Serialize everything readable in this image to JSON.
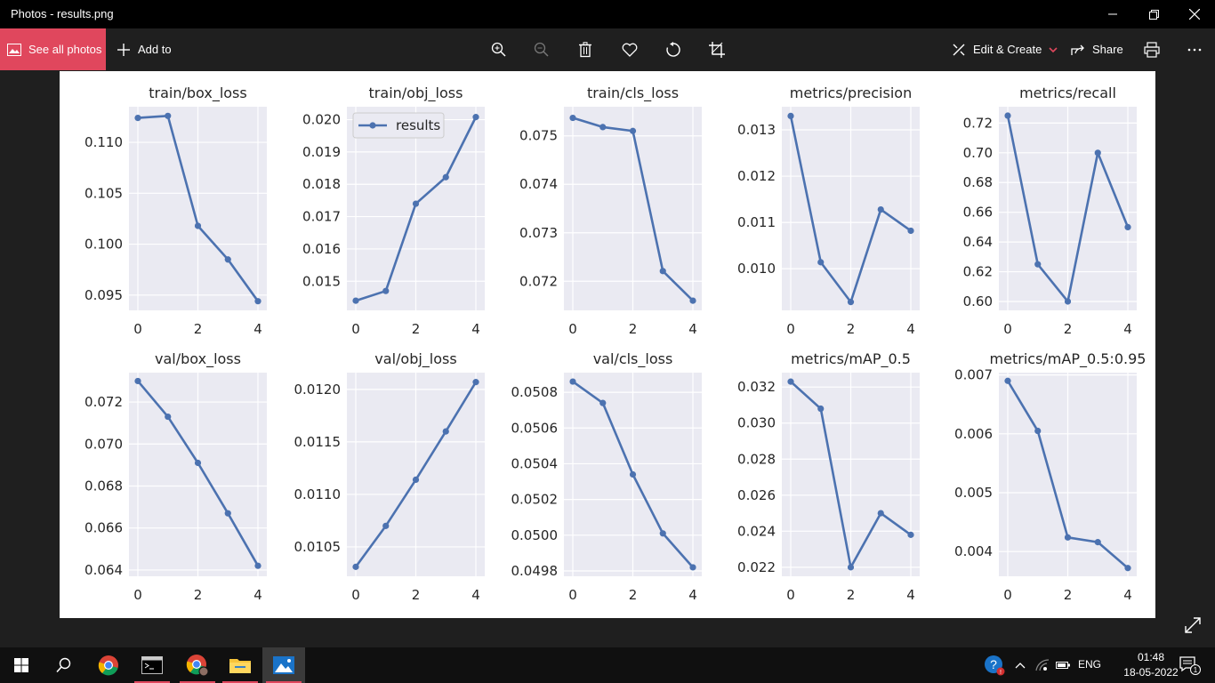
{
  "window": {
    "title": "Photos - results.png"
  },
  "toolbar": {
    "see_all_label": "See all photos",
    "add_to_label": "Add to",
    "edit_create_label": "Edit & Create",
    "share_label": "Share"
  },
  "taskbar": {
    "language": "ENG",
    "time": "01:48",
    "date": "18-05-2022",
    "notification_count": "1"
  },
  "colors": {
    "accent": "#e0475d",
    "series": "#4c72b0",
    "plot_bg": "#eaeaf2"
  },
  "chart_data": [
    {
      "type": "line",
      "title": "train/box_loss",
      "x": [
        0,
        1,
        2,
        3,
        4
      ],
      "values": [
        0.1124,
        0.1126,
        0.1018,
        0.0985,
        0.0944
      ],
      "ylim": [
        0.0935,
        0.1135
      ],
      "yticks": [
        0.095,
        0.1,
        0.105,
        0.11
      ],
      "ytick_labels": [
        "0.095",
        "0.100",
        "0.105",
        "0.110"
      ],
      "xticks": [
        "0",
        "2",
        "4"
      ],
      "grid": true
    },
    {
      "type": "line",
      "title": "train/obj_loss",
      "x": [
        0,
        1,
        2,
        3,
        4
      ],
      "values": [
        0.0144,
        0.0147,
        0.0174,
        0.01822,
        0.02008
      ],
      "ylim": [
        0.0141,
        0.0204
      ],
      "yticks": [
        0.015,
        0.016,
        0.017,
        0.018,
        0.019,
        0.02
      ],
      "ytick_labels": [
        "0.015",
        "0.016",
        "0.017",
        "0.018",
        "0.019",
        "0.020"
      ],
      "xticks": [
        "0",
        "2",
        "4"
      ],
      "legend": {
        "label": "results",
        "position": "top-left"
      },
      "grid": true
    },
    {
      "type": "line",
      "title": "train/cls_loss",
      "x": [
        0,
        1,
        2,
        3,
        4
      ],
      "values": [
        0.07537,
        0.07518,
        0.0751,
        0.07221,
        0.0716
      ],
      "ylim": [
        0.0714,
        0.0756
      ],
      "yticks": [
        0.072,
        0.073,
        0.074,
        0.075
      ],
      "ytick_labels": [
        "0.072",
        "0.073",
        "0.074",
        "0.075"
      ],
      "xticks": [
        "0",
        "2",
        "4"
      ],
      "grid": true
    },
    {
      "type": "line",
      "title": "metrics/precision",
      "x": [
        0,
        1,
        2,
        3,
        4
      ],
      "values": [
        0.0133,
        0.01014,
        0.00928,
        0.01128,
        0.01082
      ],
      "ylim": [
        0.0091,
        0.0135
      ],
      "yticks": [
        0.01,
        0.011,
        0.012,
        0.013
      ],
      "ytick_labels": [
        "0.010",
        "0.011",
        "0.012",
        "0.013"
      ],
      "xticks": [
        "0",
        "2",
        "4"
      ],
      "grid": true
    },
    {
      "type": "line",
      "title": "metrics/recall",
      "x": [
        0,
        1,
        2,
        3,
        4
      ],
      "values": [
        0.725,
        0.625,
        0.6,
        0.7,
        0.65
      ],
      "ylim": [
        0.594,
        0.731
      ],
      "yticks": [
        0.6,
        0.62,
        0.64,
        0.66,
        0.68,
        0.7,
        0.72
      ],
      "ytick_labels": [
        "0.60",
        "0.62",
        "0.64",
        "0.66",
        "0.68",
        "0.70",
        "0.72"
      ],
      "xticks": [
        "0",
        "2",
        "4"
      ],
      "grid": true
    },
    {
      "type": "line",
      "title": "val/box_loss",
      "x": [
        0,
        1,
        2,
        3,
        4
      ],
      "values": [
        0.073,
        0.0713,
        0.0691,
        0.0667,
        0.0642
      ],
      "ylim": [
        0.0637,
        0.0734
      ],
      "yticks": [
        0.064,
        0.066,
        0.068,
        0.07,
        0.072
      ],
      "ytick_labels": [
        "0.064",
        "0.066",
        "0.068",
        "0.070",
        "0.072"
      ],
      "xticks": [
        "0",
        "2",
        "4"
      ],
      "grid": true
    },
    {
      "type": "line",
      "title": "val/obj_loss",
      "x": [
        0,
        1,
        2,
        3,
        4
      ],
      "values": [
        0.01031,
        0.0107,
        0.01114,
        0.0116,
        0.01207
      ],
      "ylim": [
        0.01022,
        0.01216
      ],
      "yticks": [
        0.0105,
        0.011,
        0.0115,
        0.012
      ],
      "ytick_labels": [
        "0.0105",
        "0.0110",
        "0.0115",
        "0.0120"
      ],
      "xticks": [
        "0",
        "2",
        "4"
      ],
      "grid": true
    },
    {
      "type": "line",
      "title": "val/cls_loss",
      "x": [
        0,
        1,
        2,
        3,
        4
      ],
      "values": [
        0.05086,
        0.05074,
        0.05034,
        0.05001,
        0.04982
      ],
      "ylim": [
        0.04977,
        0.05091
      ],
      "yticks": [
        0.0498,
        0.05,
        0.0502,
        0.0504,
        0.0506,
        0.0508
      ],
      "ytick_labels": [
        "0.0498",
        "0.0500",
        "0.0502",
        "0.0504",
        "0.0506",
        "0.0508"
      ],
      "xticks": [
        "0",
        "2",
        "4"
      ],
      "grid": true
    },
    {
      "type": "line",
      "title": "metrics/mAP_0.5",
      "x": [
        0,
        1,
        2,
        3,
        4
      ],
      "values": [
        0.0323,
        0.0308,
        0.022,
        0.025,
        0.0238
      ],
      "ylim": [
        0.0215,
        0.0328
      ],
      "yticks": [
        0.022,
        0.024,
        0.026,
        0.028,
        0.03,
        0.032
      ],
      "ytick_labels": [
        "0.022",
        "0.024",
        "0.026",
        "0.028",
        "0.030",
        "0.032"
      ],
      "xticks": [
        "0",
        "2",
        "4"
      ],
      "grid": true
    },
    {
      "type": "line",
      "title": "metrics/mAP_0.5:0.95",
      "x": [
        0,
        1,
        2,
        3,
        4
      ],
      "values": [
        0.0069,
        0.00605,
        0.00424,
        0.00416,
        0.00372
      ],
      "ylim": [
        0.00358,
        0.00704
      ],
      "yticks": [
        0.004,
        0.005,
        0.006,
        0.007
      ],
      "ytick_labels": [
        "0.004",
        "0.005",
        "0.006",
        "0.007"
      ],
      "xticks": [
        "0",
        "2",
        "4"
      ],
      "grid": true
    }
  ]
}
